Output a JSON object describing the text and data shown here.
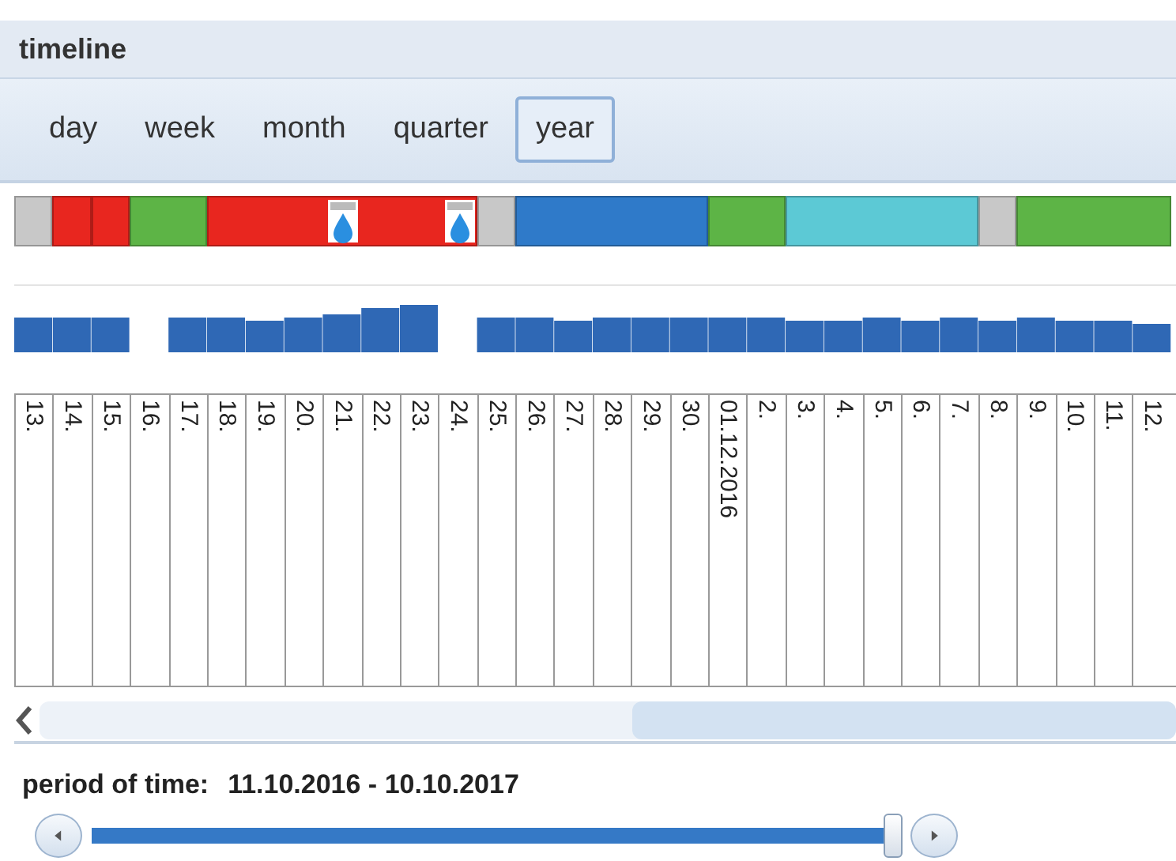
{
  "title": "timeline",
  "tabs": [
    {
      "label": "day",
      "selected": false
    },
    {
      "label": "week",
      "selected": false
    },
    {
      "label": "month",
      "selected": false
    },
    {
      "label": "quarter",
      "selected": false
    },
    {
      "label": "year",
      "selected": true
    }
  ],
  "status_segments": [
    {
      "color": "#c8c8c8",
      "days": [
        {
          "alert": false
        }
      ]
    },
    {
      "color": "#e8261f",
      "days": [
        {
          "alert": false
        }
      ]
    },
    {
      "color": "#e8261f",
      "days": [
        {
          "alert": false
        }
      ]
    },
    {
      "color": "#5db446",
      "days": [
        {
          "alert": false
        },
        {
          "alert": false
        }
      ]
    },
    {
      "color": "#e8261f",
      "days": [
        {
          "alert": false
        },
        {
          "alert": false
        },
        {
          "alert": false
        },
        {
          "alert": true
        },
        {
          "alert": false
        },
        {
          "alert": false
        },
        {
          "alert": true
        }
      ]
    },
    {
      "color": "#c8c8c8",
      "days": [
        {
          "alert": false
        }
      ]
    },
    {
      "color": "#2f7ac9",
      "days": [
        {
          "alert": false
        },
        {
          "alert": false
        },
        {
          "alert": false
        },
        {
          "alert": false
        },
        {
          "alert": false
        }
      ]
    },
    {
      "color": "#5db446",
      "days": [
        {
          "alert": false
        },
        {
          "alert": false
        }
      ]
    },
    {
      "color": "#5cc9d5",
      "days": [
        {
          "alert": false
        },
        {
          "alert": false
        },
        {
          "alert": false
        },
        {
          "alert": false
        },
        {
          "alert": false
        }
      ]
    },
    {
      "color": "#c8c8c8",
      "days": [
        {
          "alert": false
        }
      ]
    },
    {
      "color": "#5db446",
      "days": [
        {
          "alert": false
        },
        {
          "alert": false
        },
        {
          "alert": false
        },
        {
          "alert": false
        }
      ]
    }
  ],
  "days": [
    "13.",
    "14.",
    "15.",
    "16.",
    "17.",
    "18.",
    "19.",
    "20.",
    "21.",
    "22.",
    "23.",
    "24.",
    "25.",
    "26.",
    "27.",
    "28.",
    "29.",
    "30.",
    "01.12.2016",
    "2.",
    "3.",
    "4.",
    "5.",
    "6.",
    "7.",
    "8.",
    "9.",
    "10.",
    "11.",
    "12."
  ],
  "period": {
    "label": "period of time:",
    "value": "11.10.2016 - 10.10.2017"
  },
  "slider": {
    "level": 0.99
  }
}
